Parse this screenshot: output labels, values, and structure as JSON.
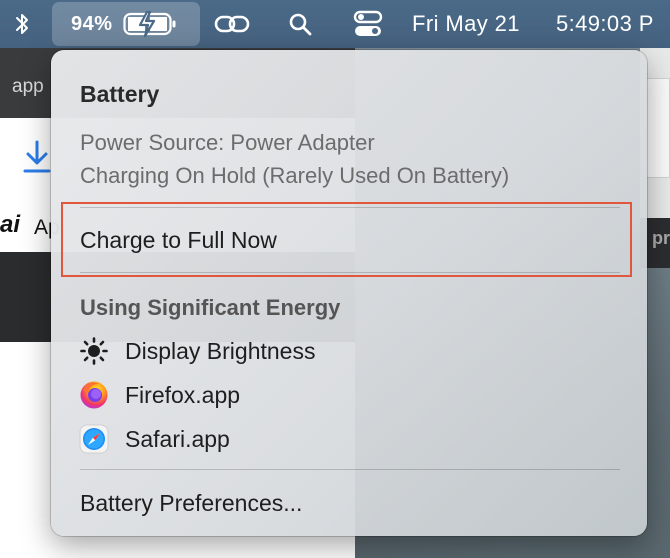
{
  "background": {
    "browser_tab_text": "app",
    "brand_text": "ai",
    "brand_text_2": "Ap",
    "right_window_text": "pr"
  },
  "menubar": {
    "bluetooth_icon": "bluetooth-icon",
    "battery_percent": "94%",
    "battery_icon": "battery-charging-icon",
    "hotspot_icon": "link-icon",
    "search_icon": "search-icon",
    "control_center_icon": "control-center-icon",
    "date": "Fri May 21",
    "time": "5:49:03 P"
  },
  "battery_menu": {
    "title": "Battery",
    "power_source": "Power Source: Power Adapter",
    "charging_status": "Charging On Hold (Rarely Used On Battery)",
    "charge_full_label": "Charge to Full Now",
    "energy_section_title": "Using Significant Energy",
    "energy_apps": [
      {
        "label": "Display Brightness",
        "icon": "brightness-icon"
      },
      {
        "label": "Firefox.app",
        "icon": "firefox-icon"
      },
      {
        "label": "Safari.app",
        "icon": "safari-icon"
      }
    ],
    "preferences_label": "Battery Preferences..."
  },
  "colors": {
    "menubar": "#4a6a88",
    "highlight_border": "#e0573d",
    "menu_bg": "#e3e5e7"
  }
}
